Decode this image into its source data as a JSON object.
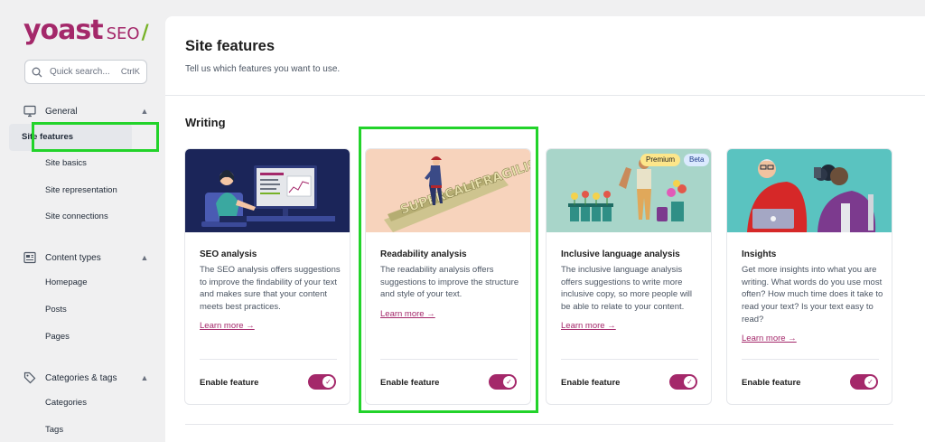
{
  "logo": {
    "brand": "yoast",
    "product": "SEO",
    "slash": "/"
  },
  "search": {
    "placeholder": "Quick search...",
    "shortcut": "CtrlK"
  },
  "sidebar": {
    "sections": [
      {
        "label": "General",
        "icon": "desktop-icon",
        "items": [
          "Site features",
          "Site basics",
          "Site representation",
          "Site connections"
        ]
      },
      {
        "label": "Content types",
        "icon": "newspaper-icon",
        "items": [
          "Homepage",
          "Posts",
          "Pages"
        ]
      },
      {
        "label": "Categories & tags",
        "icon": "tag-icon",
        "items": [
          "Categories",
          "Tags"
        ]
      }
    ],
    "active_item": "Site features"
  },
  "page": {
    "title": "Site features",
    "subtitle": "Tell us which features you want to use.",
    "section_title": "Writing"
  },
  "cards": [
    {
      "title": "SEO analysis",
      "description": "The SEO analysis offers suggestions to improve the findability of your text and makes sure that your content meets best practices.",
      "learn_more": "Learn more →",
      "enable_label": "Enable feature",
      "enabled": true
    },
    {
      "title": "Readability analysis",
      "description": "The readability analysis offers suggestions to improve the structure and style of your text.",
      "learn_more": "Learn more →",
      "enable_label": "Enable feature",
      "enabled": true
    },
    {
      "title": "Inclusive language analysis",
      "description": "The inclusive language analysis offers suggestions to write more inclusive copy, so more people will be able to relate to your content.",
      "learn_more": "Learn more →",
      "enable_label": "Enable feature",
      "enabled": true,
      "badges": [
        "Premium",
        "Beta"
      ]
    },
    {
      "title": "Insights",
      "description": "Get more insights into what you are writing. What words do you use most often? How much time does it take to read your text? Is your text easy to read?",
      "learn_more": "Learn more →",
      "enable_label": "Enable feature",
      "enabled": true
    }
  ],
  "colors": {
    "accent": "#a4286a",
    "highlight": "#22d32a",
    "premium_badge": "#fde68a",
    "beta_badge": "#dbeafe"
  },
  "illustrations": {
    "card1": "supercalifragilistic-text-illustration"
  }
}
